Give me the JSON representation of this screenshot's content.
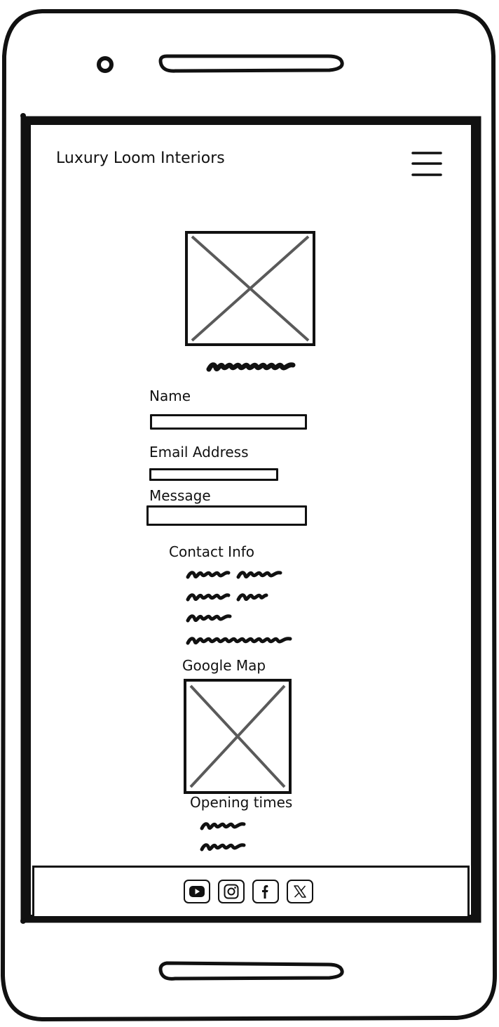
{
  "header": {
    "brand": "Luxury Loom Interiors",
    "menu_icon": "hamburger-icon"
  },
  "hero": {
    "image_icon": "image-placeholder-icon"
  },
  "form": {
    "name_label": "Name",
    "email_label": "Email Address",
    "message_label": "Message"
  },
  "contact": {
    "heading": "Contact Info"
  },
  "map": {
    "heading": "Google Map",
    "image_icon": "image-placeholder-icon"
  },
  "hours": {
    "heading": "Opening times"
  },
  "footer": {
    "social_icons": [
      "youtube-icon",
      "instagram-icon",
      "facebook-icon",
      "x-icon"
    ]
  },
  "colors": {
    "stroke": "#111111",
    "placeholder_cross": "#5a5a5a",
    "background": "#ffffff"
  }
}
